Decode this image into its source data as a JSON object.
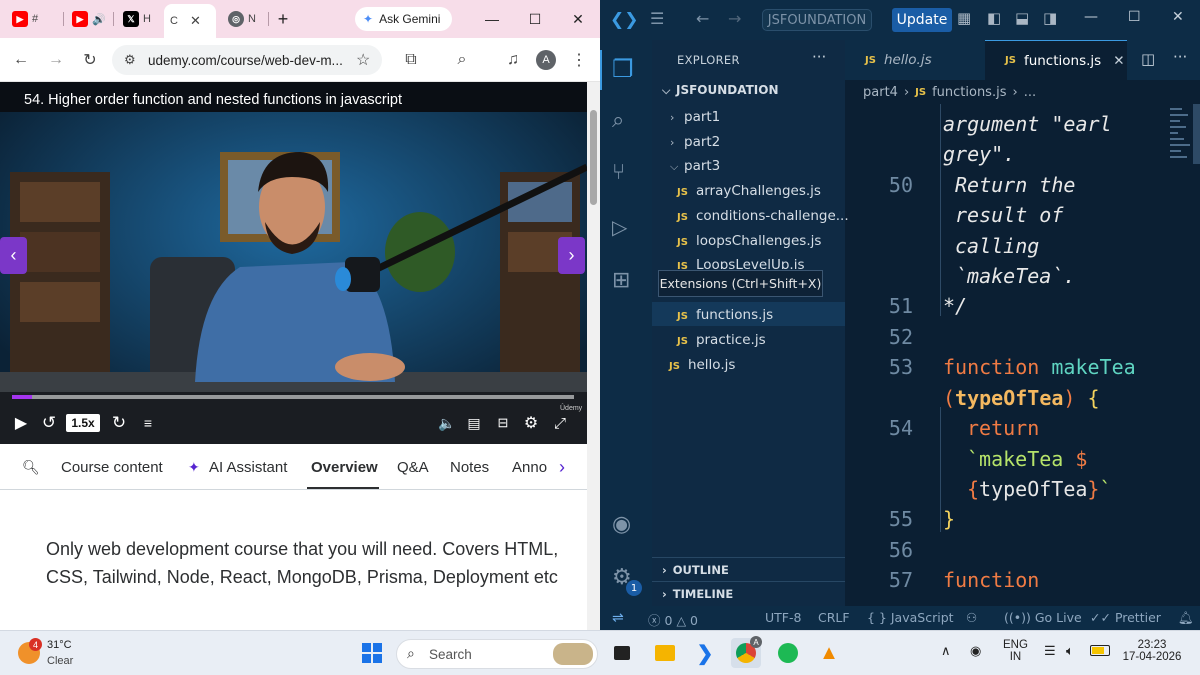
{
  "browser": {
    "tabs": [
      {
        "label": "#",
        "icon": "youtube-icon"
      },
      {
        "label": "",
        "icon": "youtube-audio-icon"
      },
      {
        "label": "H",
        "icon": "x-icon"
      },
      {
        "label": "C",
        "icon": "udemy-icon"
      },
      {
        "label": "N",
        "icon": "chrome-icon"
      }
    ],
    "gemini_label": "Ask Gemini",
    "url": "udemy.com/course/web-dev-m...",
    "profile_initial": "A"
  },
  "video": {
    "title": "54. Higher order function and nested functions in javascript",
    "speed": "1.5x",
    "progress": 0.035,
    "watermark": "Ûdemy"
  },
  "course_tabs": {
    "items": [
      "Course content",
      "AI Assistant",
      "Overview",
      "Q&A",
      "Notes",
      "Anno"
    ],
    "active": "Overview"
  },
  "description": "Only web development course that you will need. Covers HTML, CSS, Tailwind, Node, React, MongoDB, Prisma, Deployment etc",
  "vscode": {
    "command_center": "JSFOUNDATION",
    "update_label": "Update",
    "explorer_title": "EXPLORER",
    "root_folder": "JSFOUNDATION",
    "tree": {
      "part1": "part1",
      "part2": "part2",
      "part3": "part3",
      "files_part3": [
        "arrayChallenges.js",
        "conditions-challenge...",
        "loopsChallenges.js",
        "LoopsLevelUp.js"
      ],
      "files_part4": [
        "functions.js",
        "practice.js"
      ],
      "hello": "hello.js"
    },
    "tooltip": "Extensions (Ctrl+Shift+X)",
    "outline": "OUTLINE",
    "timeline": "TIMELINE",
    "js_badge": "JS",
    "editor_tabs": [
      {
        "label": "hello.js"
      },
      {
        "label": "functions.js"
      }
    ],
    "breadcrumbs": {
      "folder": "part4",
      "file": "functions.js",
      "more": "..."
    },
    "notification_count": "1",
    "code": {
      "l_a": "argument \"earl",
      "l_b": "grey\".",
      "n50": "50",
      "l50a": "Return the",
      "l50b": "result of",
      "l50c": "calling",
      "l50d": "`makeTea`.",
      "n51": "51",
      "l51": "*/",
      "n52": "52",
      "n53": "53",
      "kw_function": "function",
      "fn_makeTea": "makeTea",
      "param_open": "(",
      "param_name": "typeOfTea",
      "param_close": ")",
      "brace_open": "{",
      "n54": "54",
      "kw_return": "return",
      "str_a": "`makeTea ",
      "dollar": "$",
      "interp_open": "{",
      "interp_close": "}",
      "tick": "`",
      "n55": "55",
      "brace_close": "}",
      "n56": "56",
      "n57": "57"
    },
    "status": {
      "errors": "0",
      "warnings": "0",
      "encoding": "UTF-8",
      "eol": "CRLF",
      "language": "JavaScript",
      "golive": "Go Live",
      "prettier": "Prettier"
    }
  },
  "taskbar": {
    "weather_temp": "31°C",
    "weather_cond": "Clear",
    "weather_badge": "4",
    "search_placeholder": "Search",
    "lang": "ENG",
    "region": "IN",
    "time": "23:23",
    "date": "17-04-2026",
    "chrome_badge": "A"
  },
  "colors": {
    "udemy_purple": "#a435f0",
    "vscode_bg": "#0b1f33",
    "update_blue": "#1a5da6",
    "taskbar": "#e9eef5"
  }
}
